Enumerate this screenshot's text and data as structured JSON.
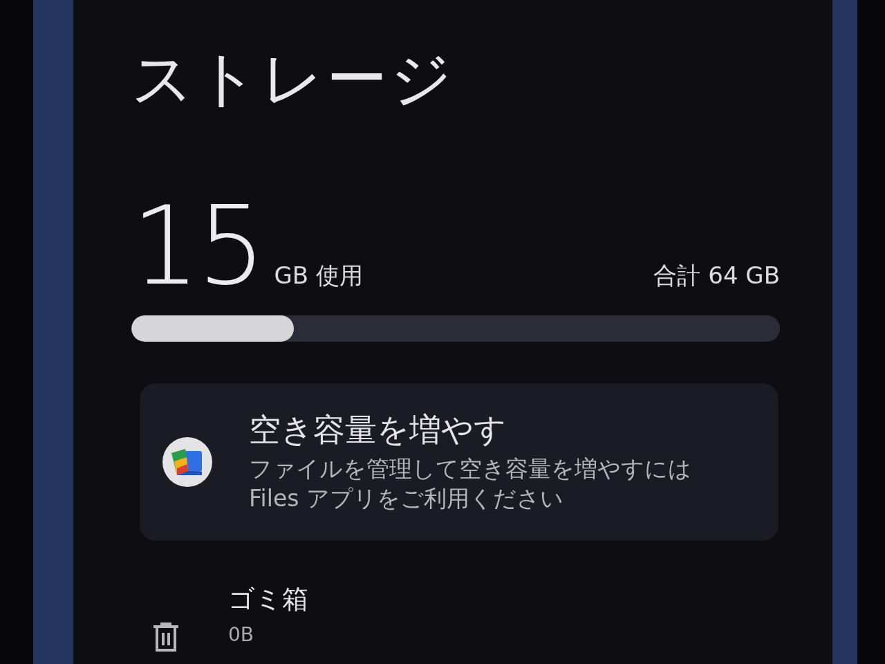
{
  "screen": {
    "title": "ストレージ"
  },
  "usage": {
    "used_value": "15",
    "used_unit": "GB 使用",
    "total": "合計 64 GB",
    "level": 0.25
  },
  "suggestion_card": {
    "title": "空き容量を増やす",
    "description": "ファイルを管理して空き容量を増やすには Files アプリをご利用ください"
  },
  "trash": {
    "label": "ゴミ箱",
    "size": "0B"
  }
}
